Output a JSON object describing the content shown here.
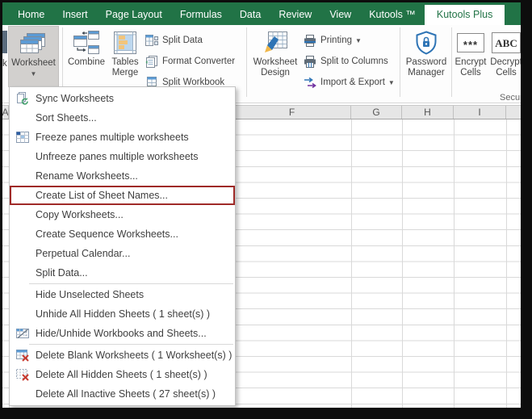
{
  "tabs": [
    {
      "label": "Home"
    },
    {
      "label": "Insert"
    },
    {
      "label": "Page Layout"
    },
    {
      "label": "Formulas"
    },
    {
      "label": "Data"
    },
    {
      "label": "Review"
    },
    {
      "label": "View"
    },
    {
      "label": "Kutools ™"
    },
    {
      "label": "Kutools Plus",
      "active": true
    }
  ],
  "ribbon": {
    "cropped_left_fragment": "k",
    "worksheet_button": {
      "label": "Worksheet",
      "dropdown_glyph": "▼",
      "pressed": true
    },
    "combine_label": "Combine",
    "tables_merge_label": "Tables Merge",
    "small_buttons_1": [
      "Split Data",
      "Format Converter",
      "Split Workbook"
    ],
    "worksheet_design_label": "Worksheet Design",
    "small_buttons_2": [
      {
        "label": "Printing",
        "dropdown_glyph": "▼"
      },
      {
        "label": "Split to Columns",
        "dropdown_glyph": ""
      },
      {
        "label": "Import & Export",
        "dropdown_glyph": "▼"
      }
    ],
    "password_manager_label": "Password Manager",
    "encrypt_cells": {
      "label": "Encrypt Cells",
      "icon_text": "***"
    },
    "decrypt_cells": {
      "label": "Decrypt Cells",
      "icon_text": "ABC"
    },
    "security_group_label": "Security"
  },
  "menu": {
    "items": [
      {
        "label": "Sync Worksheets",
        "icon": "sync-worksheets-icon"
      },
      {
        "label": "Sort Sheets..."
      },
      {
        "label": "Freeze panes multiple worksheets",
        "icon": "freeze-panes-icon"
      },
      {
        "label": "Unfreeze panes multiple worksheets"
      },
      {
        "label": "Rename Worksheets..."
      },
      {
        "label": "Create List of Sheet Names...",
        "highlighted": true
      },
      {
        "label": "Copy Worksheets..."
      },
      {
        "label": "Create Sequence Worksheets..."
      },
      {
        "label": "Perpetual Calendar..."
      },
      {
        "label": "Split Data..."
      },
      {
        "label": "Hide Unselected Sheets"
      },
      {
        "label": "Unhide All Hidden Sheets ( 1 sheet(s) )"
      },
      {
        "label": "Hide/Unhide Workbooks and Sheets...",
        "icon": "hide-unhide-icon"
      },
      {
        "label": "Delete Blank Worksheets ( 1 Worksheet(s) )",
        "icon": "delete-blank-icon"
      },
      {
        "label": "Delete All Hidden Sheets ( 1 sheet(s) )",
        "icon": "delete-hidden-icon"
      },
      {
        "label": "Delete All Inactive Sheets ( 27 sheet(s) )"
      }
    ]
  },
  "sheet": {
    "columns": [
      "A",
      "F",
      "G",
      "H",
      "I"
    ]
  },
  "colors": {
    "excel_green": "#217346",
    "highlight_red": "#9f2a28",
    "pressed_gray": "#d2d0ce",
    "icon_blue": "#5b9bd5",
    "shield_blue": "#2e74b5",
    "delete_red": "#c7392e",
    "sync_green": "#3e9e67"
  }
}
